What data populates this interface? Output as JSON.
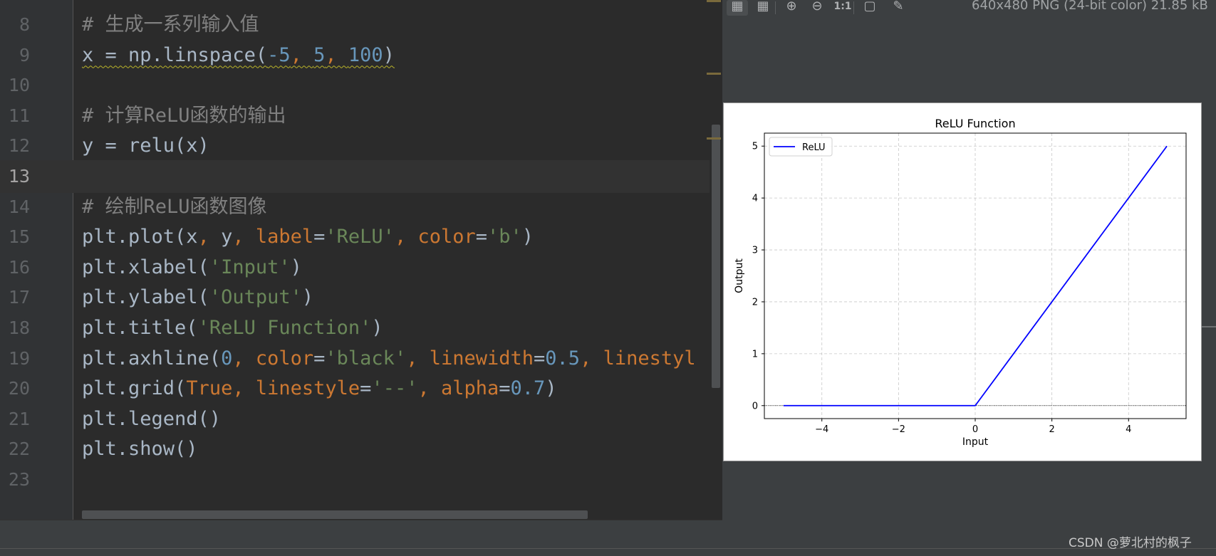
{
  "editor": {
    "lines": [
      {
        "no": "8",
        "tokens": [
          {
            "t": "# 生成一系列输入值",
            "c": "comment"
          }
        ]
      },
      {
        "no": "9",
        "tokens": [
          {
            "t": "x = np.linspace(",
            "c": "plain",
            "wavy": true
          },
          {
            "t": "-5",
            "c": "num",
            "wavy": true
          },
          {
            "t": ", ",
            "c": "kw",
            "wavy": true
          },
          {
            "t": "5",
            "c": "num",
            "wavy": true
          },
          {
            "t": ", ",
            "c": "kw",
            "wavy": true
          },
          {
            "t": "100",
            "c": "num",
            "wavy": true
          },
          {
            "t": ")",
            "c": "plain",
            "wavy": true
          }
        ]
      },
      {
        "no": "10",
        "tokens": []
      },
      {
        "no": "11",
        "tokens": [
          {
            "t": "# 计算ReLU函数的输出",
            "c": "comment"
          }
        ]
      },
      {
        "no": "12",
        "tokens": [
          {
            "t": "y = relu(x)",
            "c": "plain"
          }
        ]
      },
      {
        "no": "13",
        "tokens": [],
        "current": true
      },
      {
        "no": "14",
        "tokens": [
          {
            "t": "# 绘制ReLU函数图像",
            "c": "comment"
          }
        ]
      },
      {
        "no": "15",
        "tokens": [
          {
            "t": "plt.plot(x",
            "c": "plain"
          },
          {
            "t": ", ",
            "c": "kw"
          },
          {
            "t": "y",
            "c": "plain"
          },
          {
            "t": ", ",
            "c": "kw"
          },
          {
            "t": "label",
            "c": "param"
          },
          {
            "t": "=",
            "c": "plain"
          },
          {
            "t": "'ReLU'",
            "c": "str"
          },
          {
            "t": ", ",
            "c": "kw"
          },
          {
            "t": "color",
            "c": "param"
          },
          {
            "t": "=",
            "c": "plain"
          },
          {
            "t": "'b'",
            "c": "str"
          },
          {
            "t": ")",
            "c": "plain"
          }
        ]
      },
      {
        "no": "16",
        "tokens": [
          {
            "t": "plt.xlabel(",
            "c": "plain"
          },
          {
            "t": "'Input'",
            "c": "str"
          },
          {
            "t": ")",
            "c": "plain"
          }
        ]
      },
      {
        "no": "17",
        "tokens": [
          {
            "t": "plt.ylabel(",
            "c": "plain"
          },
          {
            "t": "'Output'",
            "c": "str"
          },
          {
            "t": ")",
            "c": "plain"
          }
        ]
      },
      {
        "no": "18",
        "tokens": [
          {
            "t": "plt.title(",
            "c": "plain"
          },
          {
            "t": "'ReLU Function'",
            "c": "str"
          },
          {
            "t": ")",
            "c": "plain"
          }
        ]
      },
      {
        "no": "19",
        "tokens": [
          {
            "t": "plt.axhline(",
            "c": "plain"
          },
          {
            "t": "0",
            "c": "num"
          },
          {
            "t": ", ",
            "c": "kw"
          },
          {
            "t": "color",
            "c": "param"
          },
          {
            "t": "=",
            "c": "plain"
          },
          {
            "t": "'black'",
            "c": "str"
          },
          {
            "t": ", ",
            "c": "kw"
          },
          {
            "t": "linewidth",
            "c": "param"
          },
          {
            "t": "=",
            "c": "plain"
          },
          {
            "t": "0.5",
            "c": "num"
          },
          {
            "t": ", ",
            "c": "kw"
          },
          {
            "t": "linestyl",
            "c": "param"
          }
        ]
      },
      {
        "no": "20",
        "tokens": [
          {
            "t": "plt.grid(",
            "c": "plain"
          },
          {
            "t": "True",
            "c": "kw"
          },
          {
            "t": ", ",
            "c": "kw"
          },
          {
            "t": "linestyle",
            "c": "param"
          },
          {
            "t": "=",
            "c": "plain"
          },
          {
            "t": "'--'",
            "c": "str"
          },
          {
            "t": ", ",
            "c": "kw"
          },
          {
            "t": "alpha",
            "c": "param"
          },
          {
            "t": "=",
            "c": "plain"
          },
          {
            "t": "0.7",
            "c": "num"
          },
          {
            "t": ")",
            "c": "plain"
          }
        ]
      },
      {
        "no": "21",
        "tokens": [
          {
            "t": "plt.legend()",
            "c": "plain"
          }
        ]
      },
      {
        "no": "22",
        "tokens": [
          {
            "t": "plt.show()",
            "c": "plain"
          }
        ]
      },
      {
        "no": "23",
        "tokens": []
      }
    ]
  },
  "viewer": {
    "toolbar": [
      {
        "name": "transparency-chessboard-icon",
        "glyph": "▦",
        "active": true
      },
      {
        "name": "grid-icon",
        "glyph": "▦"
      },
      {
        "name": "zoom-in-icon",
        "glyph": "⊕"
      },
      {
        "name": "zoom-out-icon",
        "glyph": "⊖"
      },
      {
        "name": "actual-size-icon",
        "glyph": "1:1"
      },
      {
        "name": "fit-zoom-icon",
        "glyph": "▢"
      },
      {
        "name": "color-picker-icon",
        "glyph": "✎"
      }
    ],
    "image_info": "640x480 PNG (24-bit color) 21.85 kB"
  },
  "chart_data": {
    "type": "line",
    "title": "ReLU Function",
    "xlabel": "Input",
    "ylabel": "Output",
    "xlim": [
      -5.5,
      5.5
    ],
    "ylim": [
      -0.25,
      5.25
    ],
    "xticks": [
      -4,
      -2,
      0,
      2,
      4
    ],
    "yticks": [
      0,
      1,
      2,
      3,
      4,
      5
    ],
    "xtick_labels": [
      "−4",
      "−2",
      "0",
      "2",
      "4"
    ],
    "ytick_labels": [
      "0",
      "1",
      "2",
      "3",
      "4",
      "5"
    ],
    "grid": true,
    "legend_position": "top-left",
    "series": [
      {
        "name": "ReLU",
        "color": "#0000ff",
        "x": [
          -5,
          0,
          5
        ],
        "y": [
          0,
          0,
          5
        ]
      }
    ],
    "hline": {
      "y": 0,
      "color": "#000000"
    }
  },
  "watermark": "CSDN @萝北村的枫子"
}
